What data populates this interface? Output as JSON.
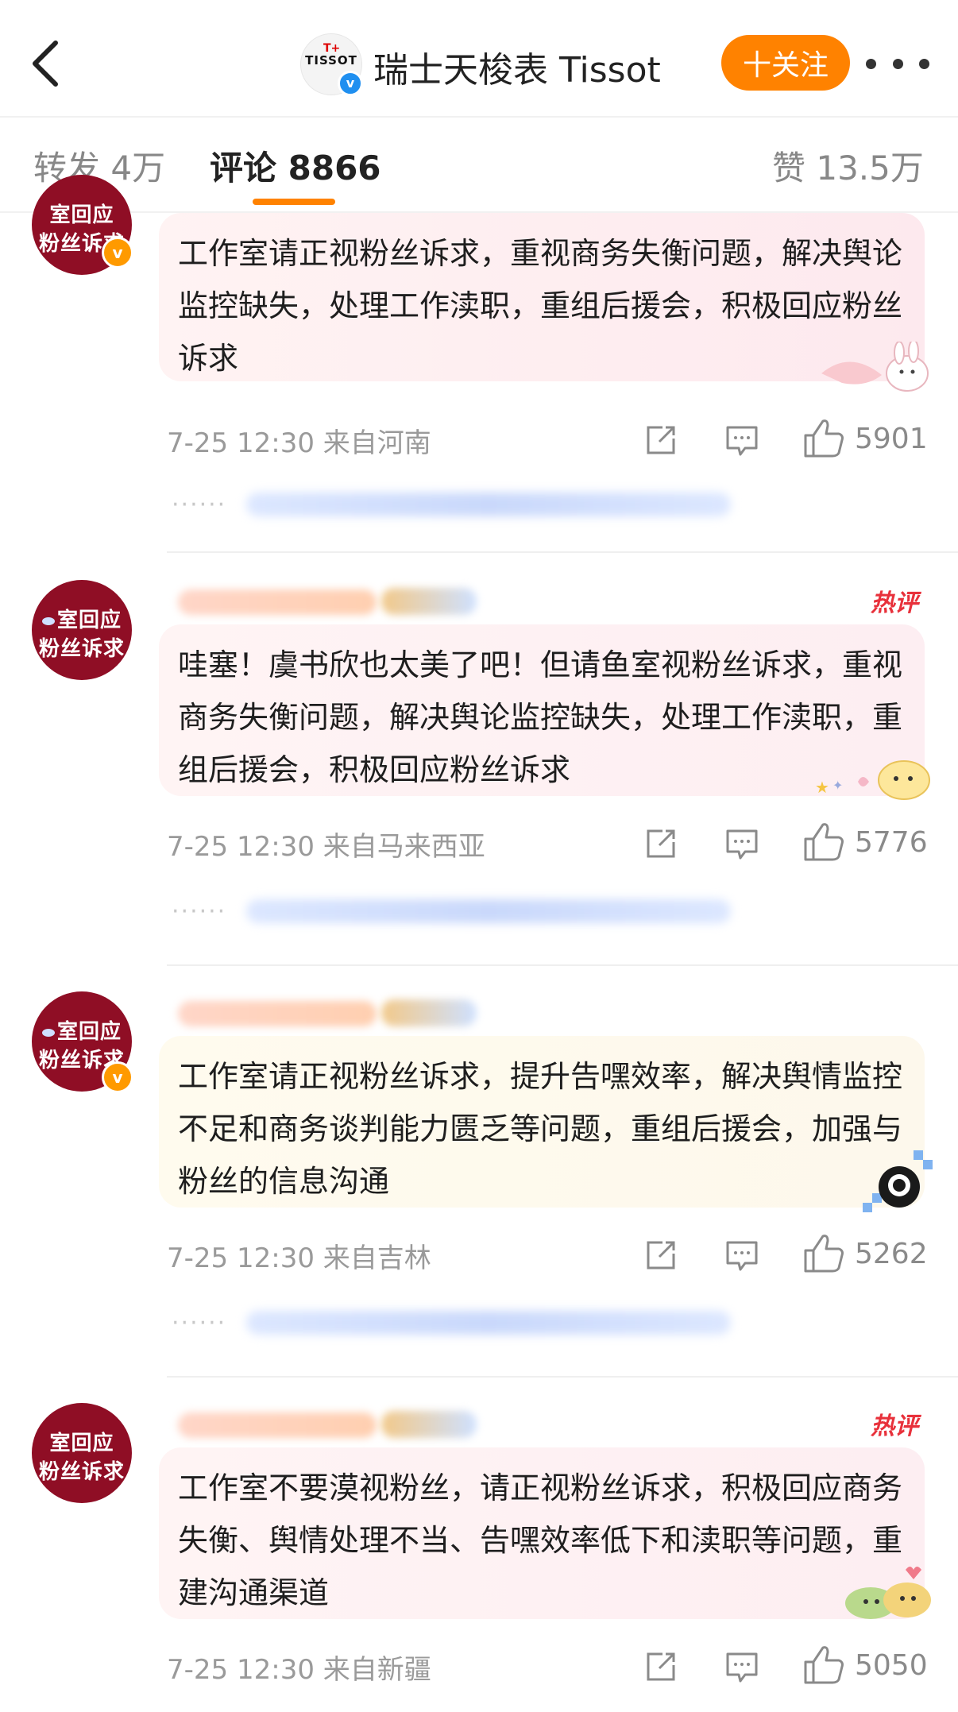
{
  "header": {
    "logo_text": "TISSOT",
    "title": "瑞士天梭表 Tissot",
    "follow_label": "十关注",
    "more_icon": "more-dots-icon"
  },
  "tabs": {
    "repost": "转发 4万",
    "comments": "评论 8866",
    "likes": "赞 13.5万"
  },
  "colors": {
    "accent": "#ff8200",
    "avatar_bg": "#8f0e25",
    "hot_label": "#e8313b",
    "verified_orange": "#ff9a00"
  },
  "comments": [
    {
      "avatar_line1": "室回应",
      "avatar_line2": "粉丝诉求",
      "text": "工作室请正视粉丝诉求，重视商务失衡问题，解决舆论监控缺失，处理工作渎职，重组后援会，积极回应粉丝诉求",
      "time": "7-25 12:30",
      "location": "来自河南",
      "likes": "5901",
      "hot": ""
    },
    {
      "avatar_line1": "室回应",
      "avatar_line2": "粉丝诉求",
      "text": "哇塞！虞书欣也太美了吧！但请鱼室视粉丝诉求，重视商务失衡问题，解决舆论监控缺失，处理工作渎职，重组后援会，积极回应粉丝诉求",
      "time": "7-25 12:30",
      "location": "来自马来西亚",
      "likes": "5776",
      "hot": "热评"
    },
    {
      "avatar_line1": "室回应",
      "avatar_line2": "粉丝诉求",
      "text": "工作室请正视粉丝诉求，提升告嘿效率，解决舆情监控不足和商务谈判能力匮乏等问题，重组后援会，加强与粉丝的信息沟通",
      "time": "7-25 12:30",
      "location": "来自吉林",
      "likes": "5262",
      "hot": ""
    },
    {
      "avatar_line1": "室回应",
      "avatar_line2": "粉丝诉求",
      "text": "工作室不要漠视粉丝，请正视粉丝诉求，积极回应商务失衡、舆情处理不当、告嘿效率低下和渎职等问题，重建沟通渠道",
      "time": "7-25 12:30",
      "location": "来自新疆",
      "likes": "5050",
      "hot": "热评"
    }
  ]
}
